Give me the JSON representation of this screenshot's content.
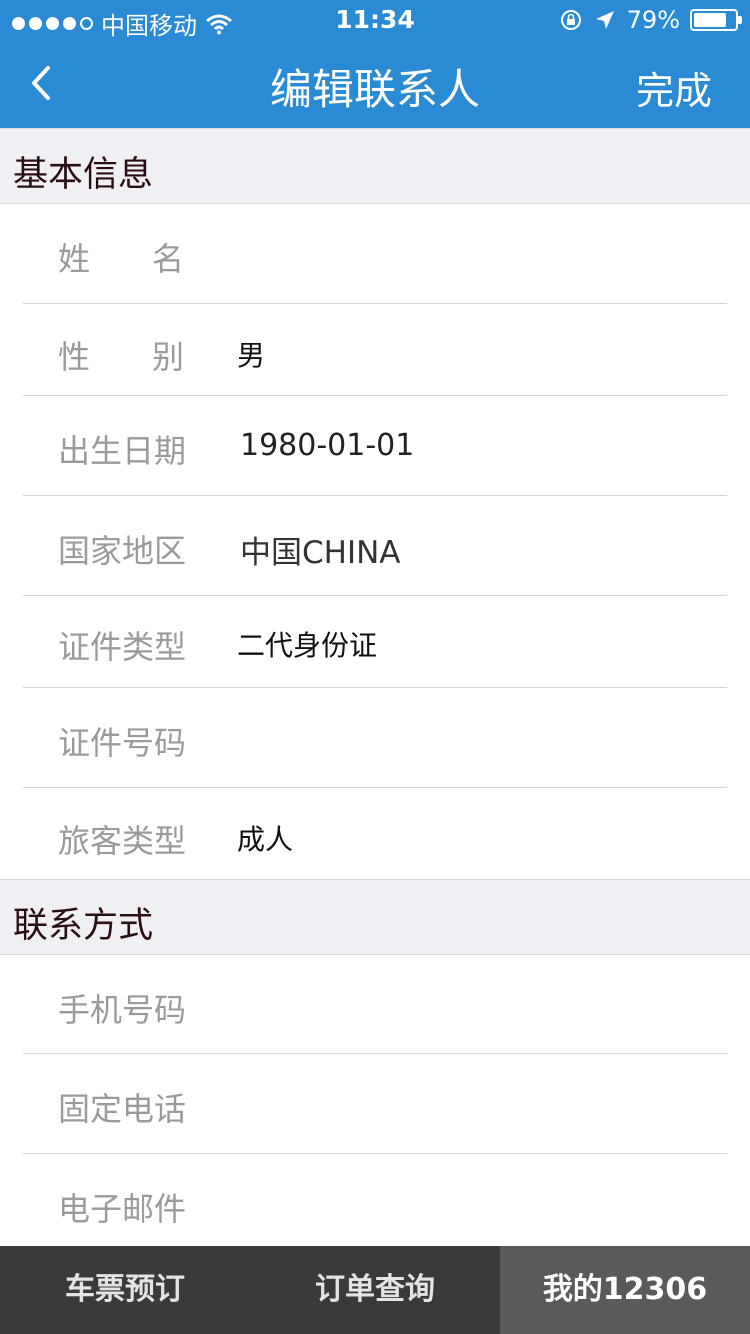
{
  "status_bar": {
    "carrier": "中国移动",
    "time": "11:34",
    "battery": "79%",
    "icons": [
      "signal-dots",
      "wifi-icon",
      "rotation-lock-icon",
      "location-icon",
      "battery-icon"
    ],
    "battery_level": 0.79
  },
  "nav": {
    "title": "编辑联系人",
    "back_icon": "chevron-left-icon",
    "done_label": "完成",
    "background": "#2a8ad4"
  },
  "sections": {
    "basic": {
      "title": "基本信息"
    },
    "contact": {
      "title": "联系方式"
    }
  },
  "basic_fields": {
    "name": {
      "label": "姓名",
      "value": ""
    },
    "gender": {
      "label": "性别",
      "value": "男"
    },
    "birth_date": {
      "label": "出生日期",
      "value": "1980-01-01"
    },
    "country": {
      "label": "国家地区",
      "value": "中国CHINA"
    },
    "id_type": {
      "label": "证件类型",
      "value": "二代身份证"
    },
    "id_number": {
      "label": "证件号码",
      "value": ""
    },
    "passenger_type": {
      "label": "旅客类型",
      "value": "成人"
    }
  },
  "contact_fields": {
    "mobile": {
      "label": "手机号码",
      "value": ""
    },
    "landline": {
      "label": "固定电话",
      "value": ""
    },
    "email": {
      "label": "电子邮件",
      "value": ""
    }
  },
  "tabbar": {
    "items": [
      {
        "label": "车票预订",
        "active": false
      },
      {
        "label": "订单查询",
        "active": false
      },
      {
        "label": "我的12306",
        "active": true
      }
    ]
  }
}
